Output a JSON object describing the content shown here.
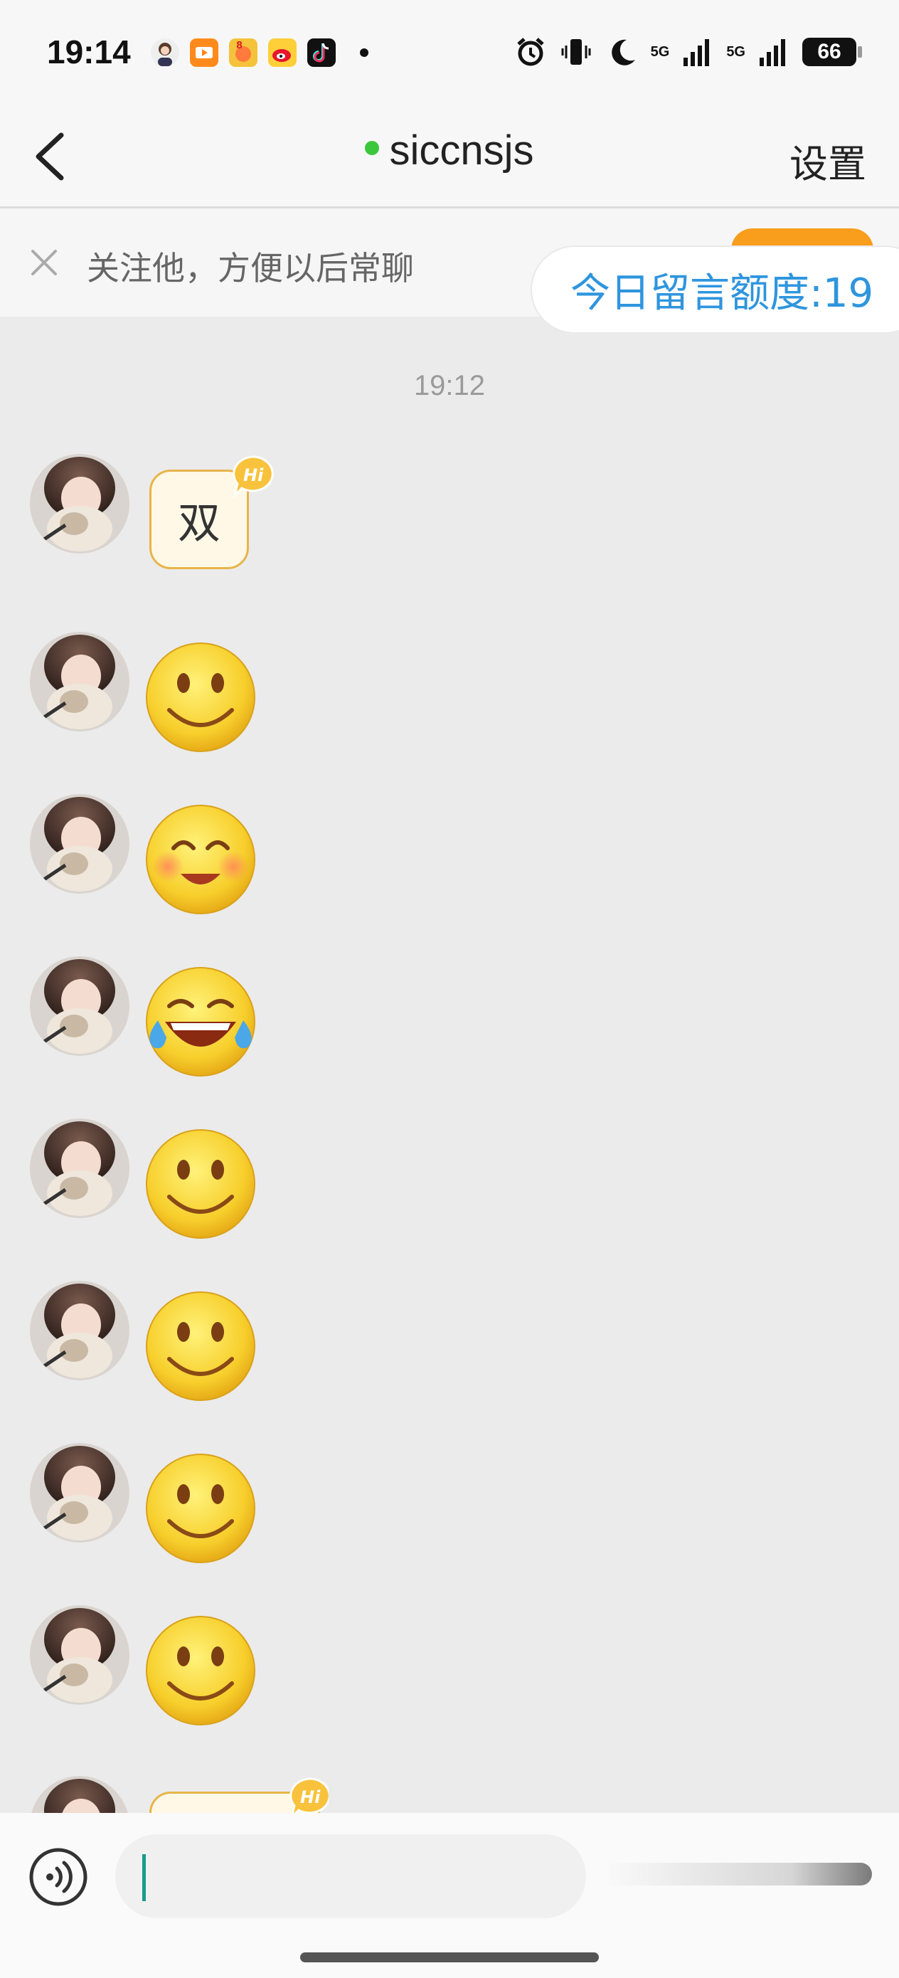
{
  "status_bar": {
    "time": "19:14",
    "battery": "66",
    "network_1": "5G",
    "network_2": "5G",
    "icons": [
      "avatar-app-icon",
      "video-app-icon",
      "game-app-icon",
      "weibo-icon",
      "tiktok-icon",
      "alarm-icon",
      "vibrate-icon",
      "moon-icon",
      "signal-icon"
    ]
  },
  "nav": {
    "title": "siccnsjs",
    "settings_label": "设置",
    "online_color": "#3cc63c"
  },
  "follow_banner": {
    "text": "关注他，方便以后常聊"
  },
  "quota": {
    "label": "今日留言额度:19"
  },
  "chat": {
    "timestamp": "19:12",
    "messages": [
      {
        "type": "hi-sticker",
        "text": "双",
        "badge": "Hi"
      },
      {
        "type": "emoji",
        "emoji": "smile-emoji"
      },
      {
        "type": "emoji",
        "emoji": "blush-emoji"
      },
      {
        "type": "emoji",
        "emoji": "laugh-tears-emoji"
      },
      {
        "type": "emoji",
        "emoji": "smile-emoji"
      },
      {
        "type": "emoji",
        "emoji": "smile-emoji"
      },
      {
        "type": "emoji",
        "emoji": "smile-emoji"
      },
      {
        "type": "emoji",
        "emoji": "smile-emoji"
      },
      {
        "type": "hi-sticker",
        "text": "",
        "badge": "Hi"
      }
    ]
  },
  "input": {
    "value": "",
    "accent": "#1a9a8c"
  },
  "colors": {
    "link_blue": "#2f95de",
    "orange": "#f99d1c",
    "background": "#ebebeb"
  }
}
